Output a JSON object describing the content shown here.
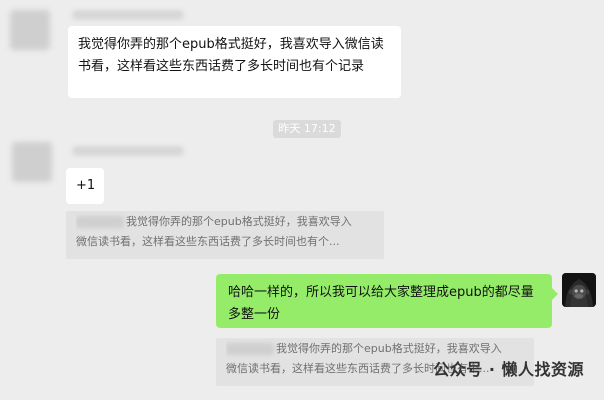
{
  "messages": {
    "first": {
      "text": "我觉得你弄的那个epub格式挺好，我喜欢导入微信读书看，这样看这些东西话费了多长时间也有个记录"
    },
    "time": "昨天 17:12",
    "plus": "+1",
    "quote1": {
      "line1": "我觉得你弄的那个epub格式挺好，我喜欢导入",
      "line2": "微信读书看，这样看这些东西话费了多长时间也有个..."
    },
    "self": {
      "text": "哈哈一样的，所以我可以给大家整理成epub的都尽量多整一份"
    },
    "quote2": {
      "line1": "我觉得你弄的那个epub格式挺好，我喜欢导入",
      "line2": "微信读书看，这样看这些东西话费了多长时间也有个..."
    }
  },
  "watermark": "公众号 · 懒人找资源",
  "colors": {
    "background": "#ededed",
    "white_bubble": "#ffffff",
    "green_bubble": "#95ec69",
    "quote_bg": "#e2e2e2",
    "time_pill": "#dadada"
  },
  "icons": {
    "self_avatar": "hooded-monkey-avatar-icon"
  }
}
